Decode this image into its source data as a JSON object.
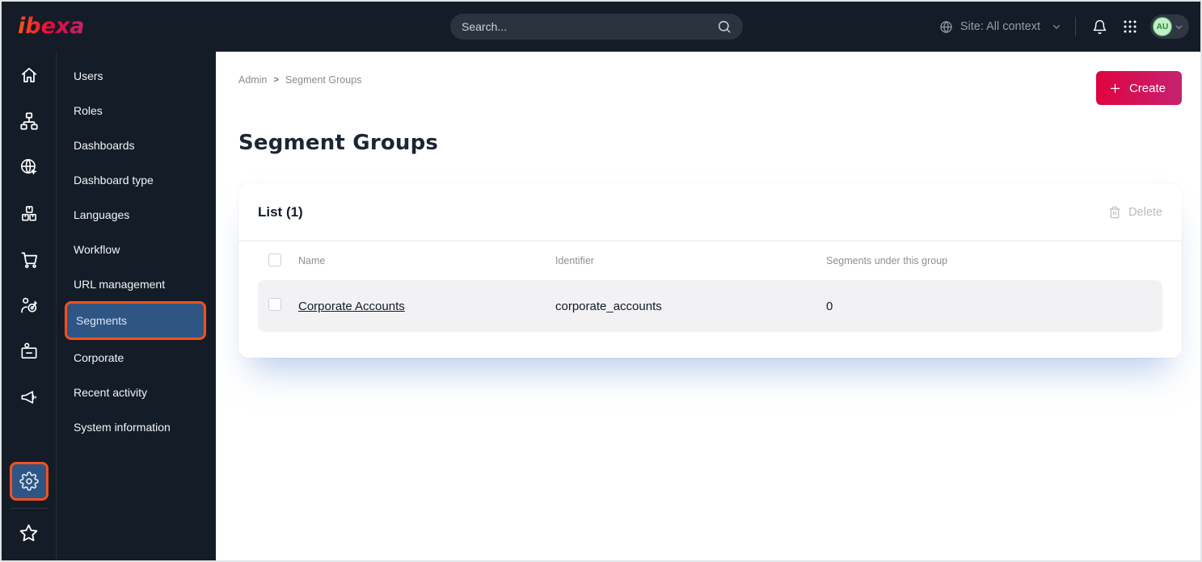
{
  "topbar": {
    "logo_text": "ibexa",
    "search_placeholder": "Search...",
    "site_context_label": "Site: All context",
    "avatar_initials": "AU"
  },
  "icon_sidebar": {
    "items": [
      "home",
      "content-tree",
      "site",
      "products",
      "commerce",
      "personalization",
      "corporate",
      "campaigns",
      "admin",
      "bookmarks"
    ],
    "active_item": "admin"
  },
  "sidebar": {
    "menu_items": [
      "Users",
      "Roles",
      "Dashboards",
      "Dashboard type",
      "Languages",
      "Workflow",
      "URL management",
      "Segments",
      "Corporate",
      "Recent activity",
      "System information"
    ],
    "active_item": "Segments"
  },
  "main": {
    "breadcrumb": {
      "items": [
        "Admin",
        "Segment Groups"
      ],
      "separator": ">"
    },
    "title": "Segment Groups",
    "create_label": "Create"
  },
  "table": {
    "card_title": "List (1)",
    "delete_label": "Delete",
    "columns": [
      "Name",
      "Identifier",
      "Segments under this group"
    ],
    "rows": [
      {
        "name": "Corporate Accounts",
        "identifier": "corporate_accounts",
        "segments_count": "0"
      }
    ]
  },
  "colors": {
    "topbar_bg": "#141c27",
    "accent_orange": "#f4501e",
    "active_blue": "#2e5584",
    "primary_gradient_start": "#e00341",
    "primary_gradient_end": "#c62270",
    "row_bg": "#f2f2f4",
    "muted_text": "#878b90",
    "dark_text": "#131c26",
    "avatar_green": "#44b354"
  }
}
